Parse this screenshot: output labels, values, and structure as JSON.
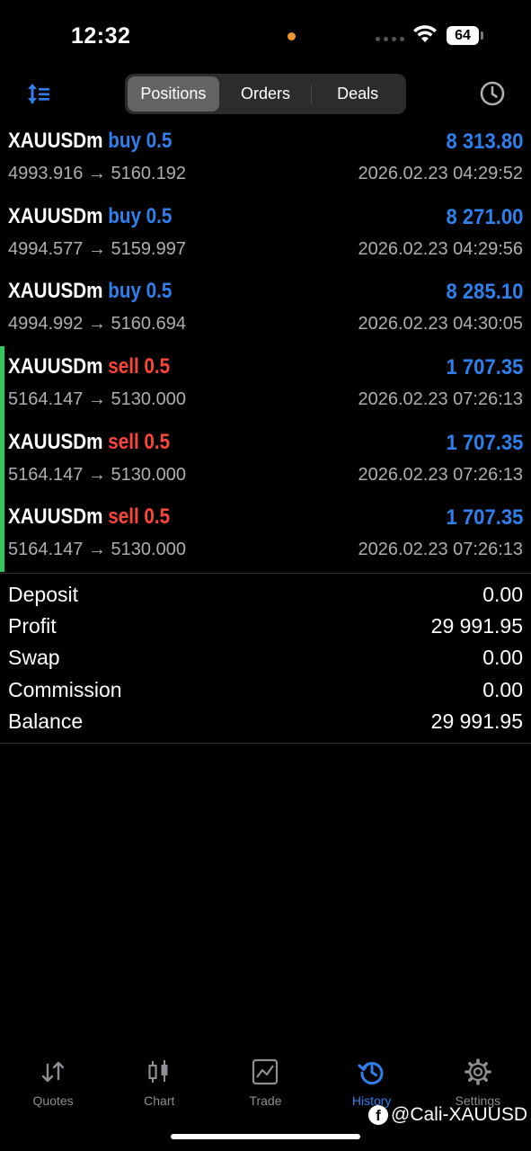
{
  "status_bar": {
    "time": "12:32",
    "battery": "64"
  },
  "toolbar": {
    "tabs": [
      {
        "label": "Positions",
        "active": true
      },
      {
        "label": "Orders",
        "active": false
      },
      {
        "label": "Deals",
        "active": false
      }
    ]
  },
  "positions": [
    {
      "symbol": "XAUUSDm",
      "direction": "buy",
      "volume": "0.5",
      "open": "4993.916",
      "close": "5160.192",
      "profit": "8 313.80",
      "datetime": "2026.02.23 04:29:52"
    },
    {
      "symbol": "XAUUSDm",
      "direction": "buy",
      "volume": "0.5",
      "open": "4994.577",
      "close": "5159.997",
      "profit": "8 271.00",
      "datetime": "2026.02.23 04:29:56"
    },
    {
      "symbol": "XAUUSDm",
      "direction": "buy",
      "volume": "0.5",
      "open": "4994.992",
      "close": "5160.694",
      "profit": "8 285.10",
      "datetime": "2026.02.23 04:30:05"
    },
    {
      "symbol": "XAUUSDm",
      "direction": "sell",
      "volume": "0.5",
      "open": "5164.147",
      "close": "5130.000",
      "profit": "1 707.35",
      "datetime": "2026.02.23 07:26:13"
    },
    {
      "symbol": "XAUUSDm",
      "direction": "sell",
      "volume": "0.5",
      "open": "5164.147",
      "close": "5130.000",
      "profit": "1 707.35",
      "datetime": "2026.02.23 07:26:13"
    },
    {
      "symbol": "XAUUSDm",
      "direction": "sell",
      "volume": "0.5",
      "open": "5164.147",
      "close": "5130.000",
      "profit": "1 707.35",
      "datetime": "2026.02.23 07:26:13"
    }
  ],
  "arrow": "→",
  "summary": [
    {
      "label": "Deposit",
      "value": "0.00"
    },
    {
      "label": "Profit",
      "value": "29 991.95"
    },
    {
      "label": "Swap",
      "value": "0.00"
    },
    {
      "label": "Commission",
      "value": "0.00"
    },
    {
      "label": "Balance",
      "value": "29 991.95"
    }
  ],
  "tabbar": [
    {
      "label": "Quotes",
      "icon": "quotes-arrows-icon",
      "active": false
    },
    {
      "label": "Chart",
      "icon": "candlestick-chart-icon",
      "active": false
    },
    {
      "label": "Trade",
      "icon": "trade-line-chart-icon",
      "active": false
    },
    {
      "label": "History",
      "icon": "history-clock-icon",
      "active": true
    },
    {
      "label": "Settings",
      "icon": "gear-icon",
      "active": false
    }
  ],
  "watermark": "@Cali-XAUUSD",
  "colors": {
    "accent": "#2f80ed",
    "sell": "#ff453a",
    "sell_marker": "#34c759",
    "muted": "#aeaeb2"
  }
}
